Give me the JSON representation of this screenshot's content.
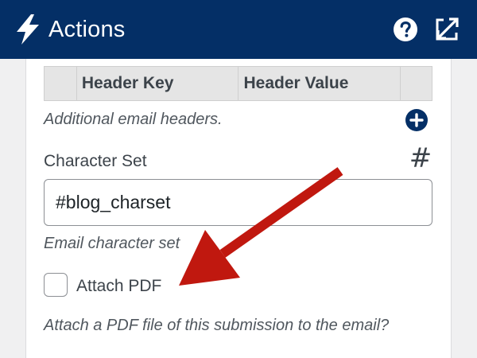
{
  "header": {
    "title": "Actions",
    "bolt_icon": "bolt-icon",
    "help_icon": "question-circle-icon",
    "expand_icon": "expand-icon",
    "background": "#042f66"
  },
  "headers_table": {
    "columns": [
      "Header Key",
      "Header Value"
    ],
    "description": "Additional email headers.",
    "add_icon": "plus-circle-icon"
  },
  "character_set": {
    "label": "Character Set",
    "value": "#blog_charset",
    "description": "Email character set",
    "merge_tag_icon": "hash-icon"
  },
  "attach_pdf": {
    "label": "Attach PDF",
    "checked": false,
    "description": "Attach a PDF file of this submission to the email?"
  },
  "annotation": {
    "arrow_color": "#c0180f"
  }
}
